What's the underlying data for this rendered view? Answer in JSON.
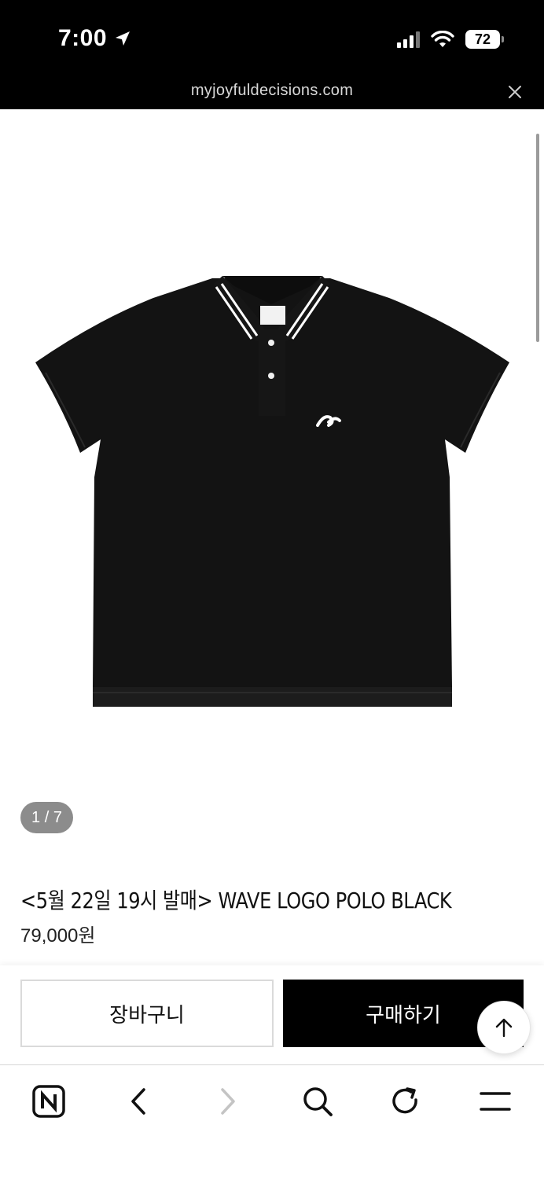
{
  "status_bar": {
    "time": "7:00",
    "battery": "72"
  },
  "browser": {
    "url": "myjoyfuldecisions.com"
  },
  "product": {
    "image_counter": "1 / 7",
    "title": "<5월 22일 19시 발매> WAVE LOGO POLO BLACK",
    "price": "79,000원",
    "shirt_color": "#131313"
  },
  "actions": {
    "cart_label": "장바구니",
    "buy_label": "구매하기"
  },
  "icons": {
    "location": "location-arrow-icon",
    "signal": "cellular-signal-icon",
    "wifi": "wifi-icon",
    "close": "close-icon",
    "scroll_top": "arrow-up-icon",
    "toolbar": [
      "naver-home-icon",
      "back-icon",
      "forward-icon",
      "search-icon",
      "reload-icon",
      "menu-icon"
    ]
  }
}
